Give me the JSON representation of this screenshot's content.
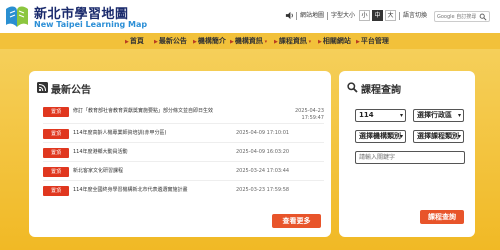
{
  "brand": {
    "name_cn": "新北市學習地圖",
    "name_en": "New Taipei Learning Map"
  },
  "utility": {
    "sitemap": "網站地圖",
    "font_size_label": "字型大小",
    "font_sizes": [
      "小",
      "中",
      "大"
    ],
    "lang_switch": "語言切換",
    "search_placeholder": "Google 自訂搜尋"
  },
  "nav": [
    "首頁",
    "最新公告",
    "機構簡介",
    "機構資訊",
    "課程資訊",
    "相關網站",
    "平台管理"
  ],
  "news": {
    "title": "最新公告",
    "badge": "置頂",
    "items": [
      {
        "text": "修訂「教育部社會教育貢獻獎實施要點」部分條文並自即日生效",
        "date": "2025-04-23 17:59:47"
      },
      {
        "text": "114年度高齡人機專業師資培訓(赤甲分區)",
        "date": "2025-04-09 17:10:01"
      },
      {
        "text": "114年度港鄉大動員活動",
        "date": "2025-04-09 16:03:20"
      },
      {
        "text": "新北客家文化研習課程",
        "date": "2025-03-24 17:03:44"
      },
      {
        "text": "114年度全國終身學習機構新北市代表遴選實施計畫",
        "date": "2025-03-23 17:59:58"
      }
    ],
    "more_label": "查看更多"
  },
  "course": {
    "title": "課程查詢",
    "year": "114",
    "district_placeholder": "選擇行政區",
    "org_placeholder": "選擇機構類別",
    "category_placeholder": "選擇課程類別",
    "keyword_placeholder": "請輸入關鍵字",
    "query_label": "課程查詢"
  },
  "colors": {
    "accent": "#f2c13a",
    "button": "#e8542a",
    "badge": "#e0371f",
    "brand_dark": "#1a2a6c",
    "brand_blue": "#2c8fd6"
  }
}
